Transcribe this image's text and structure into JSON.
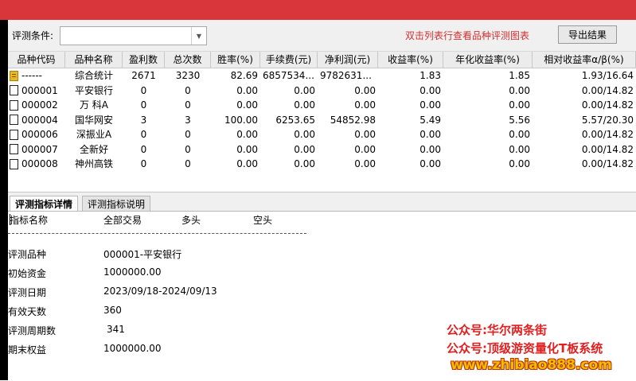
{
  "toolbar": {
    "condition_label": "评测条件:",
    "condition_value": "",
    "hint_text": "双击列表行查看品种评测图表",
    "export_label": "导出结果"
  },
  "table": {
    "headers": [
      "品种代码",
      "品种名称",
      "盈利数",
      "总次数",
      "胜率(%)",
      "手续费(元)",
      "净利润(元)",
      "收益率(%)",
      "年化收益率(%)",
      "相对收益率α/β(%)"
    ],
    "rows": [
      {
        "icon": "summary-icon",
        "code": "------",
        "name": "综合统计",
        "profits": "2671",
        "total": "3230",
        "win_rate": "82.69",
        "fee": "6857534...",
        "net_profit": "9782631...",
        "return_rate": "1.83",
        "annual_return": "1.85",
        "relative_return": "1.93/16.64"
      },
      {
        "icon": "document-icon",
        "code": "000001",
        "name": "平安银行",
        "profits": "0",
        "total": "0",
        "win_rate": "0.00",
        "fee": "0.00",
        "net_profit": "0.00",
        "return_rate": "0.00",
        "annual_return": "0.00",
        "relative_return": "0.00/14.82"
      },
      {
        "icon": "document-icon",
        "code": "000002",
        "name": "万 科A",
        "profits": "0",
        "total": "0",
        "win_rate": "0.00",
        "fee": "0.00",
        "net_profit": "0.00",
        "return_rate": "0.00",
        "annual_return": "0.00",
        "relative_return": "0.00/14.82"
      },
      {
        "icon": "document-icon",
        "code": "000004",
        "name": "国华网安",
        "profits": "3",
        "total": "3",
        "win_rate": "100.00",
        "fee": "6253.65",
        "net_profit": "54852.98",
        "return_rate": "5.49",
        "annual_return": "5.56",
        "relative_return": "5.57/20.30"
      },
      {
        "icon": "document-icon",
        "code": "000006",
        "name": "深振业A",
        "profits": "0",
        "total": "0",
        "win_rate": "0.00",
        "fee": "0.00",
        "net_profit": "0.00",
        "return_rate": "0.00",
        "annual_return": "0.00",
        "relative_return": "0.00/14.82"
      },
      {
        "icon": "document-icon",
        "code": "000007",
        "name": "全新好",
        "profits": "0",
        "total": "0",
        "win_rate": "0.00",
        "fee": "0.00",
        "net_profit": "0.00",
        "return_rate": "0.00",
        "annual_return": "0.00",
        "relative_return": "0.00/14.82"
      },
      {
        "icon": "document-icon",
        "code": "000008",
        "name": "神州高铁",
        "profits": "0",
        "total": "0",
        "win_rate": "0.00",
        "fee": "0.00",
        "net_profit": "0.00",
        "return_rate": "0.00",
        "annual_return": "0.00",
        "relative_return": "0.00/14.82"
      }
    ]
  },
  "tabs": [
    {
      "label": "评测指标详情",
      "active": true
    },
    {
      "label": "评测指标说明",
      "active": false
    }
  ],
  "detail": {
    "header": {
      "name": "指标名称",
      "all": "全部交易",
      "long": "多头",
      "short": "空头"
    },
    "separator": "-----------------------------------------------------------------",
    "items": [
      {
        "label": "评测品种",
        "value": "000001-平安银行"
      },
      {
        "label": "初始资金",
        "value": "1000000.00"
      },
      {
        "label": "评测日期",
        "value": "2023/09/18-2024/09/13"
      },
      {
        "label": "有效天数",
        "value": "360"
      },
      {
        "label": "评测周期数",
        "value": "341"
      },
      {
        "label": "期末权益",
        "value": "1000000.00"
      }
    ]
  },
  "watermark": {
    "line1": "公众号:华尔两条街",
    "line2": "公众号:顶级游资量化T板系统",
    "line3": "www.zhibiao888.com"
  },
  "colors": {
    "title_bar": "#d9363b",
    "hint_red": "#d03030",
    "watermark_red": "#e02020",
    "watermark_yellow": "#f0c000"
  }
}
